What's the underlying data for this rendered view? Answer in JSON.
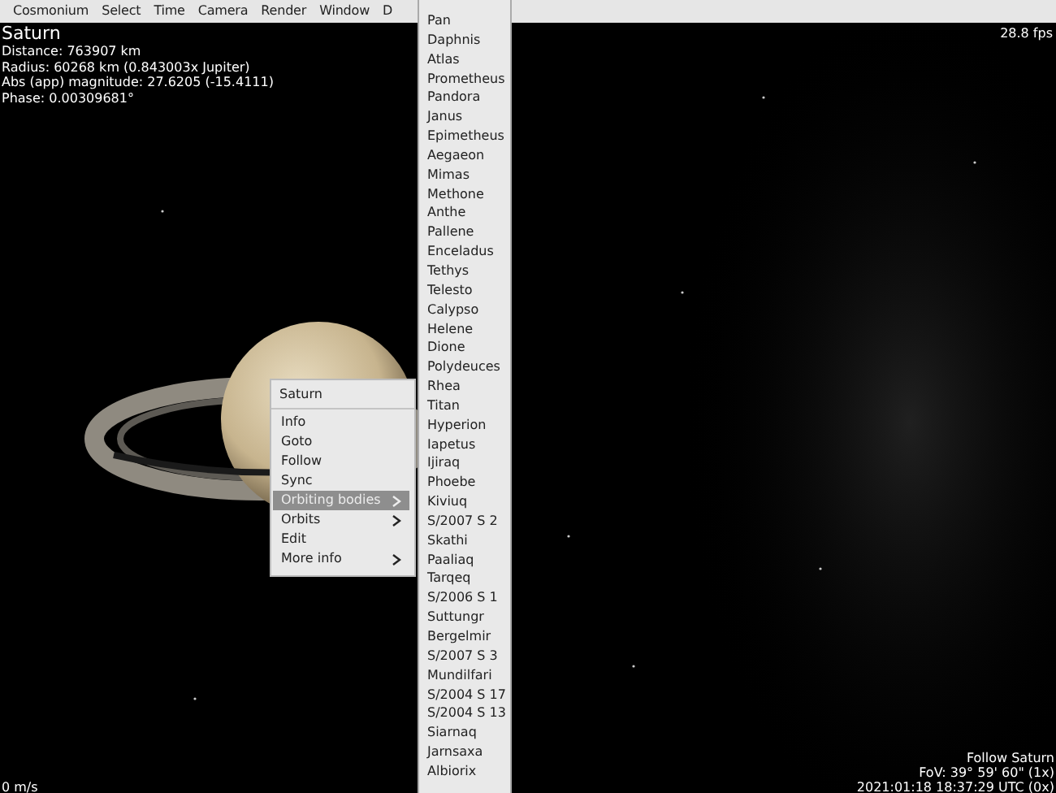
{
  "menu_bar": {
    "items": [
      {
        "label": "Cosmonium"
      },
      {
        "label": "Select"
      },
      {
        "label": "Time"
      },
      {
        "label": "Camera"
      },
      {
        "label": "Render"
      },
      {
        "label": "Window"
      },
      {
        "label": "D"
      }
    ]
  },
  "info": {
    "title": "Saturn",
    "lines": [
      "Distance: 763907 km",
      "Radius: 60268 km (0.843003x Jupiter)",
      "Abs (app) magnitude: 27.6205 (-15.4111)",
      "Phase: 0.00309681°"
    ]
  },
  "fps": "28.8 fps",
  "speed": "0 m/s",
  "status": [
    "Follow Saturn",
    "FoV: 39° 59' 60\" (1x)",
    "2021:01:18 18:37:29 UTC (0x)"
  ],
  "context_menu": {
    "title": "Saturn",
    "items": [
      {
        "label": "Info",
        "has_submenu": false,
        "selected": false
      },
      {
        "label": "Goto",
        "has_submenu": false,
        "selected": false
      },
      {
        "label": "Follow",
        "has_submenu": false,
        "selected": false
      },
      {
        "label": "Sync",
        "has_submenu": false,
        "selected": false
      },
      {
        "label": "Orbiting bodies",
        "has_submenu": true,
        "selected": true
      },
      {
        "label": "Orbits",
        "has_submenu": true,
        "selected": false
      },
      {
        "label": "Edit",
        "has_submenu": false,
        "selected": false
      },
      {
        "label": "More info",
        "has_submenu": true,
        "selected": false
      }
    ]
  },
  "submenu": {
    "items": [
      "Pan",
      "Daphnis",
      "Atlas",
      "Prometheus",
      "Pandora",
      "Janus",
      "Epimetheus",
      "Aegaeon",
      "Mimas",
      "Methone",
      "Anthe",
      "Pallene",
      "Enceladus",
      "Tethys",
      "Telesto",
      "Calypso",
      "Helene",
      "Dione",
      "Polydeuces",
      "Rhea",
      "Titan",
      "Hyperion",
      "Iapetus",
      "Ijiraq",
      "Phoebe",
      "Kiviuq",
      "S/2007 S 2",
      "Skathi",
      "Paaliaq",
      "Tarqeq",
      "S/2006 S 1",
      "Suttungr",
      "Bergelmir",
      "S/2007 S 3",
      "Mundilfari",
      "S/2004 S 17",
      "S/2004 S 13",
      "Siarnaq",
      "Jarnsaxa",
      "Albiorix"
    ]
  }
}
